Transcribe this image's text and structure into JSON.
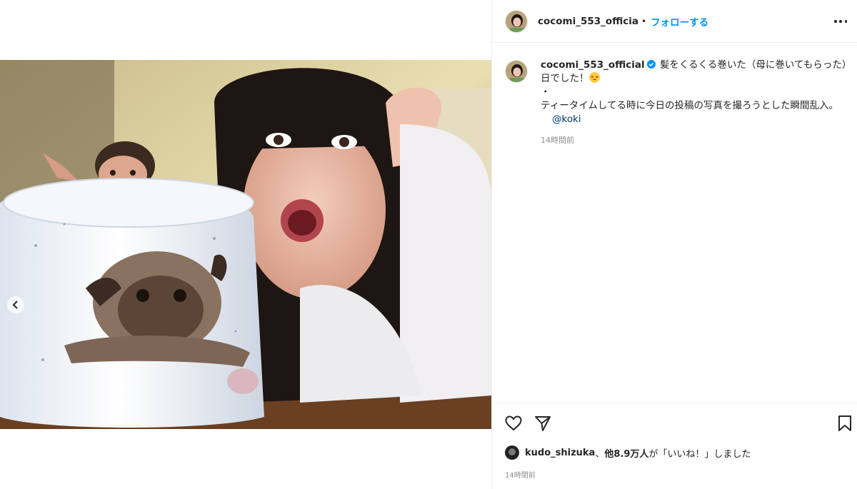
{
  "post": {
    "username": "cocomi_553_official",
    "header_username": "cocomi_553_officia",
    "separator": "•",
    "follow_label": "フォローする",
    "caption_line1": "髪をくるくる巻いた（母に巻いてもらった）日でした！",
    "caption_bullet": "・",
    "caption_line2": "ティータイムしてる時に今日の投稿の写真を撮ろうとした瞬間乱入。",
    "mention": "@koki",
    "caption_time": "14時間前",
    "post_time": "14時間前"
  },
  "likes": {
    "liker": "kudo_shizuka",
    "connector": "、",
    "others": "他8.9万人",
    "suffix": "が「いいね！」しました"
  },
  "icons": {
    "more": "more-options-icon",
    "like": "heart-icon",
    "share": "send-icon",
    "save": "bookmark-icon",
    "verified": "verified-badge-icon",
    "prev": "chevron-left-icon"
  },
  "colors": {
    "accent": "#0095f6",
    "verified": "#0095f6",
    "muted": "#8e8e8e",
    "text": "#262626"
  }
}
